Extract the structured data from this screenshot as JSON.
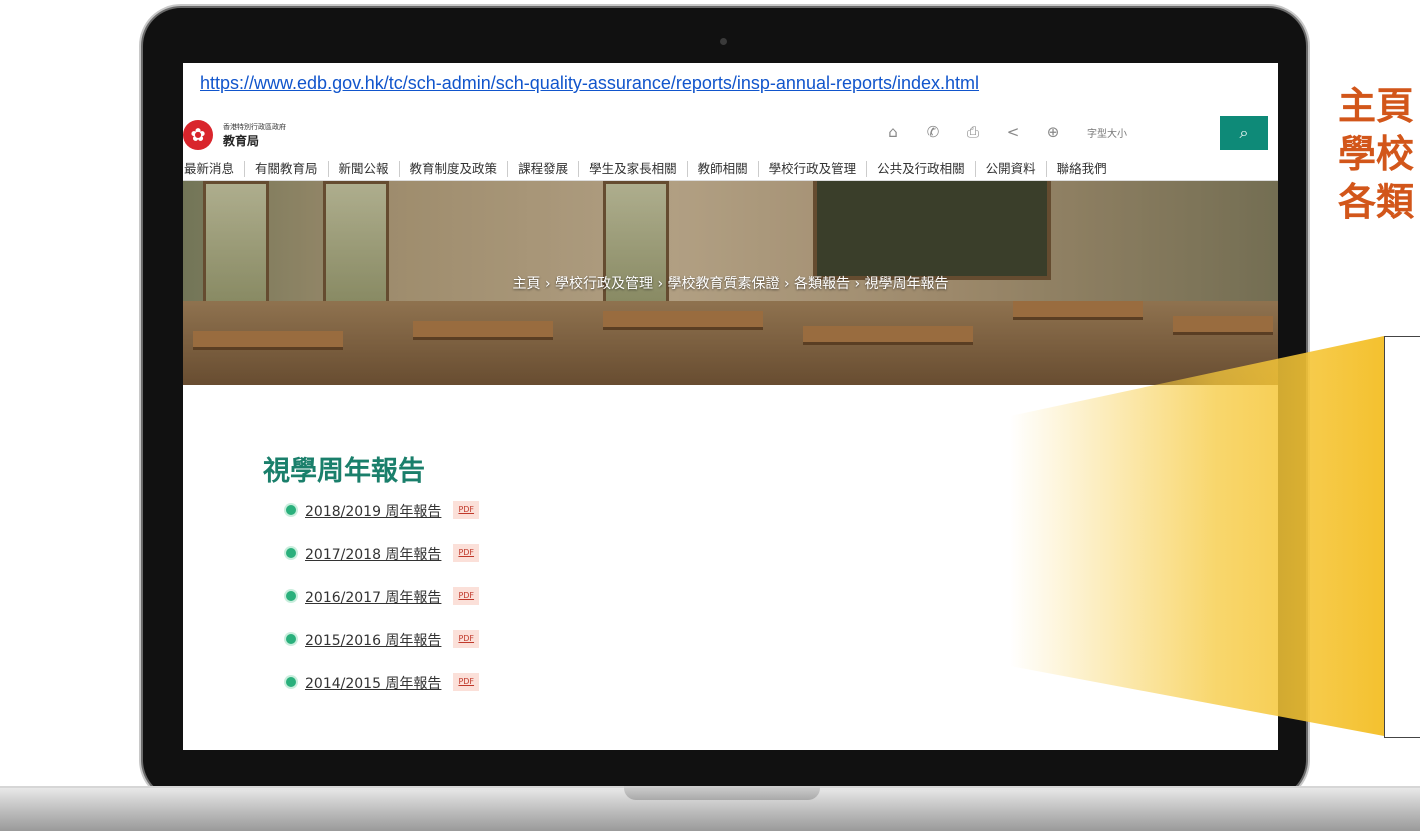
{
  "browser": {
    "url": "https://www.edb.gov.hk/tc/sch-admin/sch-quality-assurance/reports/insp-annual-reports/index.html"
  },
  "header": {
    "org_small": "香港特別行政區政府",
    "org_name": "教育局",
    "tool_icons": [
      "home-icon",
      "phone-icon",
      "print-icon",
      "share-icon",
      "globe-icon"
    ],
    "font_size_label": "字型大小",
    "search_icon": "search-icon"
  },
  "nav": {
    "items": [
      "最新消息",
      "有關教育局",
      "新聞公報",
      "教育制度及政策",
      "課程發展",
      "學生及家長相關",
      "教師相關",
      "學校行政及管理",
      "公共及行政相關",
      "公開資料",
      "聯絡我們"
    ]
  },
  "breadcrumb": "主頁 › 學校行政及管理 › 學校教育質素保證 › 各類報告 › 視學周年報告",
  "page": {
    "title": "視學周年報告",
    "reports": [
      {
        "label": "2018/2019 周年報告",
        "badge": "PDF"
      },
      {
        "label": "2017/2018 周年報告",
        "badge": "PDF"
      },
      {
        "label": "2016/2017 周年報告",
        "badge": "PDF"
      },
      {
        "label": "2015/2016 周年報告",
        "badge": "PDF"
      },
      {
        "label": "2014/2015 周年報告",
        "badge": "PDF"
      }
    ]
  },
  "overlay": {
    "heading_lines": [
      "主頁",
      "學校",
      "各類"
    ]
  },
  "colors": {
    "accent": "#0e8a78",
    "title": "#1a7f6b",
    "overlay_heading": "#d2561a",
    "highlight": "#f6c93c"
  }
}
